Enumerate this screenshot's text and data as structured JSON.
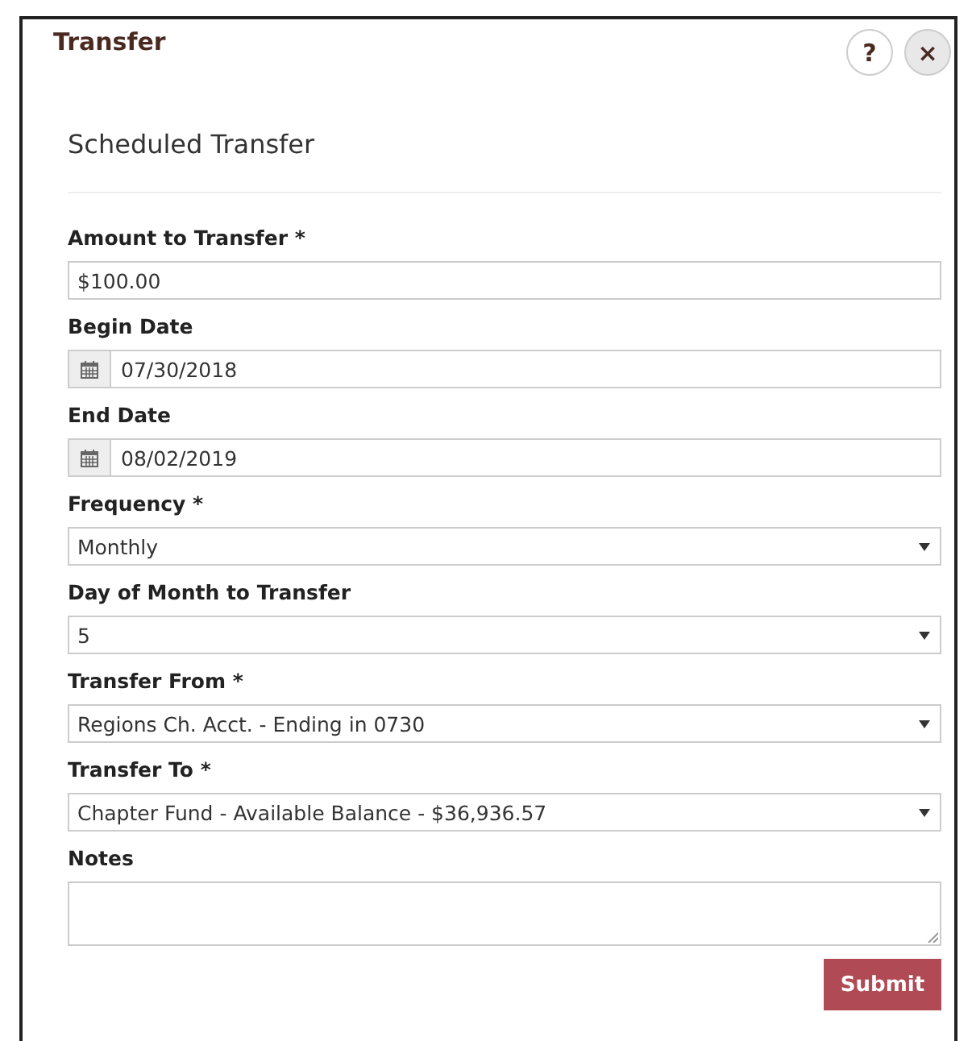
{
  "dialog": {
    "title": "Transfer",
    "help_button": "?",
    "close_button": "×"
  },
  "section_title": "Scheduled Transfer",
  "fields": [
    {
      "kind": "text",
      "label": "Amount to Transfer *",
      "value": "$100.00"
    },
    {
      "kind": "date",
      "label": "Begin Date",
      "value": "07/30/2018"
    },
    {
      "kind": "date",
      "label": "End Date",
      "value": "08/02/2019"
    },
    {
      "kind": "select",
      "label": "Frequency *",
      "value": "Monthly"
    },
    {
      "kind": "select",
      "label": "Day of Month to Transfer",
      "value": "5"
    },
    {
      "kind": "select",
      "label": "Transfer From *",
      "value": "Regions Ch. Acct. - Ending in 0730"
    },
    {
      "kind": "select",
      "label": "Transfer To *",
      "value": "Chapter Fund - Available Balance - $36,936.57"
    },
    {
      "kind": "textarea",
      "label": "Notes"
    }
  ],
  "submit_button": "Submit"
}
